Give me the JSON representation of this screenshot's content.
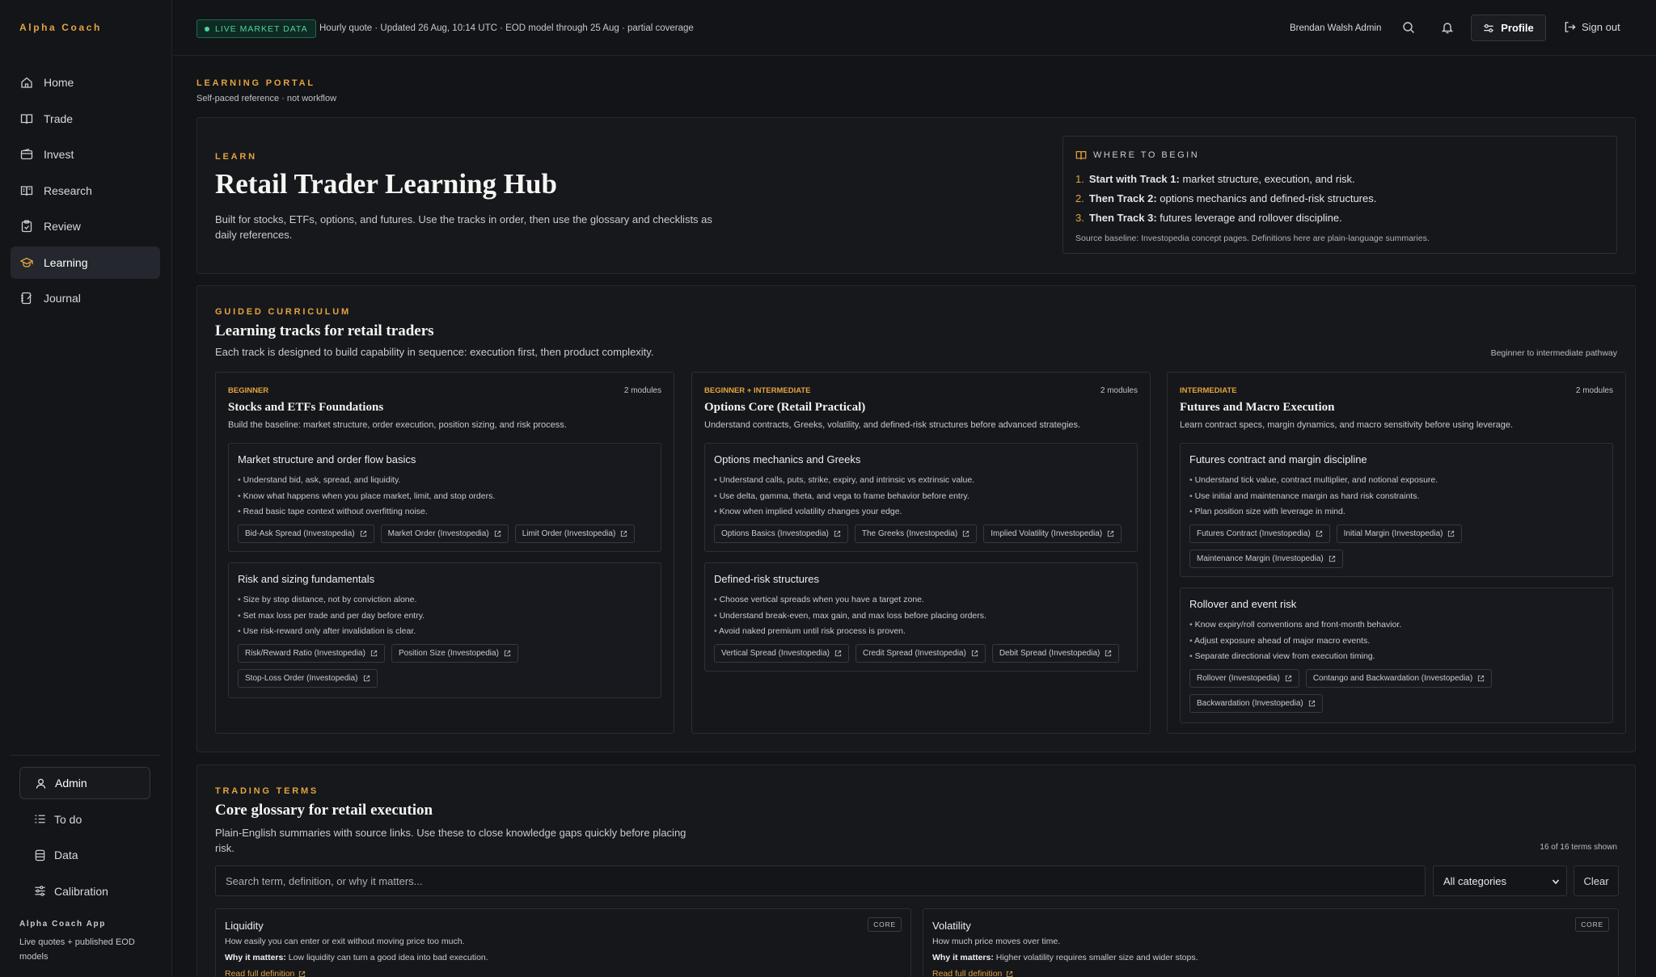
{
  "app": {
    "brand": "Alpha Coach"
  },
  "sidebar": {
    "items": [
      {
        "label": "Home",
        "icon": "home-icon"
      },
      {
        "label": "Trade",
        "icon": "book-icon"
      },
      {
        "label": "Invest",
        "icon": "wallet-icon"
      },
      {
        "label": "Research",
        "icon": "book-open-icon"
      },
      {
        "label": "Review",
        "icon": "clipboard-icon"
      },
      {
        "label": "Learning",
        "icon": "graduation-cap-icon",
        "active": true
      },
      {
        "label": "Journal",
        "icon": "notebook-icon"
      }
    ],
    "admin": {
      "label": "Admin",
      "items": [
        {
          "label": "To do",
          "icon": "list-icon"
        },
        {
          "label": "Data",
          "icon": "database-icon"
        },
        {
          "label": "Calibration",
          "icon": "sliders-icon"
        }
      ]
    },
    "footer": {
      "title": "Alpha Coach App",
      "desc": "Live quotes + published EOD models"
    }
  },
  "topbar": {
    "live_badge": "LIVE MARKET DATA",
    "status": "Hourly quote · Updated 26 Aug, 10:14 UTC · EOD model through 25 Aug · partial coverage",
    "user": "Brendan Walsh Admin",
    "profile_label": "Profile",
    "signout_label": "Sign out"
  },
  "portal": {
    "kicker": "LEARNING PORTAL",
    "sub": "Self-paced reference · not workflow"
  },
  "hero": {
    "kicker": "LEARN",
    "title": "Retail Trader Learning Hub",
    "desc": "Built for stocks, ETFs, options, and futures. Use the tracks in order, then use the glossary and checklists as daily references.",
    "begin": {
      "title": "WHERE TO BEGIN",
      "steps": [
        {
          "n": "1.",
          "bold": "Start with Track 1:",
          "text": " market structure, execution, and risk."
        },
        {
          "n": "2.",
          "bold": "Then Track 2:",
          "text": " options mechanics and defined-risk structures."
        },
        {
          "n": "3.",
          "bold": "Then Track 3:",
          "text": " futures leverage and rollover discipline."
        }
      ],
      "source": "Source baseline: Investopedia concept pages. Definitions here are plain-language summaries."
    }
  },
  "curriculum": {
    "kicker": "GUIDED CURRICULUM",
    "title": "Learning tracks for retail traders",
    "desc": "Each track is designed to build capability in sequence: execution first, then product complexity.",
    "pathway": "Beginner to intermediate pathway",
    "tracks": [
      {
        "level": "BEGINNER",
        "modules_count": "2 modules",
        "title": "Stocks and ETFs Foundations",
        "desc": "Build the baseline: market structure, order execution, position sizing, and risk process.",
        "modules": [
          {
            "title": "Market structure and order flow basics",
            "bullets": [
              "Understand bid, ask, spread, and liquidity.",
              "Know what happens when you place market, limit, and stop orders.",
              "Read basic tape context without overfitting noise."
            ],
            "links": [
              "Bid-Ask Spread (Investopedia)",
              "Market Order (Investopedia)",
              "Limit Order (Investopedia)"
            ]
          },
          {
            "title": "Risk and sizing fundamentals",
            "bullets": [
              "Size by stop distance, not by conviction alone.",
              "Set max loss per trade and per day before entry.",
              "Use risk-reward only after invalidation is clear."
            ],
            "links": [
              "Risk/Reward Ratio (Investopedia)",
              "Position Size (Investopedia)",
              "Stop-Loss Order (Investopedia)"
            ]
          }
        ]
      },
      {
        "level": "BEGINNER + INTERMEDIATE",
        "modules_count": "2 modules",
        "title": "Options Core (Retail Practical)",
        "desc": "Understand contracts, Greeks, volatility, and defined-risk structures before advanced strategies.",
        "modules": [
          {
            "title": "Options mechanics and Greeks",
            "bullets": [
              "Understand calls, puts, strike, expiry, and intrinsic vs extrinsic value.",
              "Use delta, gamma, theta, and vega to frame behavior before entry.",
              "Know when implied volatility changes your edge."
            ],
            "links": [
              "Options Basics (Investopedia)",
              "The Greeks (Investopedia)",
              "Implied Volatility (Investopedia)"
            ]
          },
          {
            "title": "Defined-risk structures",
            "bullets": [
              "Choose vertical spreads when you have a target zone.",
              "Understand break-even, max gain, and max loss before placing orders.",
              "Avoid naked premium until risk process is proven."
            ],
            "links": [
              "Vertical Spread (Investopedia)",
              "Credit Spread (Investopedia)",
              "Debit Spread (Investopedia)"
            ]
          }
        ]
      },
      {
        "level": "INTERMEDIATE",
        "modules_count": "2 modules",
        "title": "Futures and Macro Execution",
        "desc": "Learn contract specs, margin dynamics, and macro sensitivity before using leverage.",
        "modules": [
          {
            "title": "Futures contract and margin discipline",
            "bullets": [
              "Understand tick value, contract multiplier, and notional exposure.",
              "Use initial and maintenance margin as hard risk constraints.",
              "Plan position size with leverage in mind."
            ],
            "links": [
              "Futures Contract (Investopedia)",
              "Initial Margin (Investopedia)",
              "Maintenance Margin (Investopedia)"
            ]
          },
          {
            "title": "Rollover and event risk",
            "bullets": [
              "Know expiry/roll conventions and front-month behavior.",
              "Adjust exposure ahead of major macro events.",
              "Separate directional view from execution timing."
            ],
            "links": [
              "Rollover (Investopedia)",
              "Contango and Backwardation (Investopedia)",
              "Backwardation (Investopedia)"
            ]
          }
        ]
      }
    ]
  },
  "glossary": {
    "kicker": "TRADING TERMS",
    "title": "Core glossary for retail execution",
    "desc": "Plain-English summaries with source links. Use these to close knowledge gaps quickly before placing risk.",
    "count": "16 of 16 terms shown",
    "search_placeholder": "Search term, definition, or why it matters...",
    "category": "All categories",
    "clear_label": "Clear",
    "terms": [
      {
        "name": "Liquidity",
        "tag": "CORE",
        "def": "How easily you can enter or exit without moving price too much.",
        "why_label": "Why it matters:",
        "why": " Low liquidity can turn a good idea into bad execution.",
        "more": "Read full definition"
      },
      {
        "name": "Volatility",
        "tag": "CORE",
        "def": "How much price moves over time.",
        "why_label": "Why it matters:",
        "why": " Higher volatility requires smaller size and wider stops.",
        "more": "Read full definition"
      }
    ]
  }
}
